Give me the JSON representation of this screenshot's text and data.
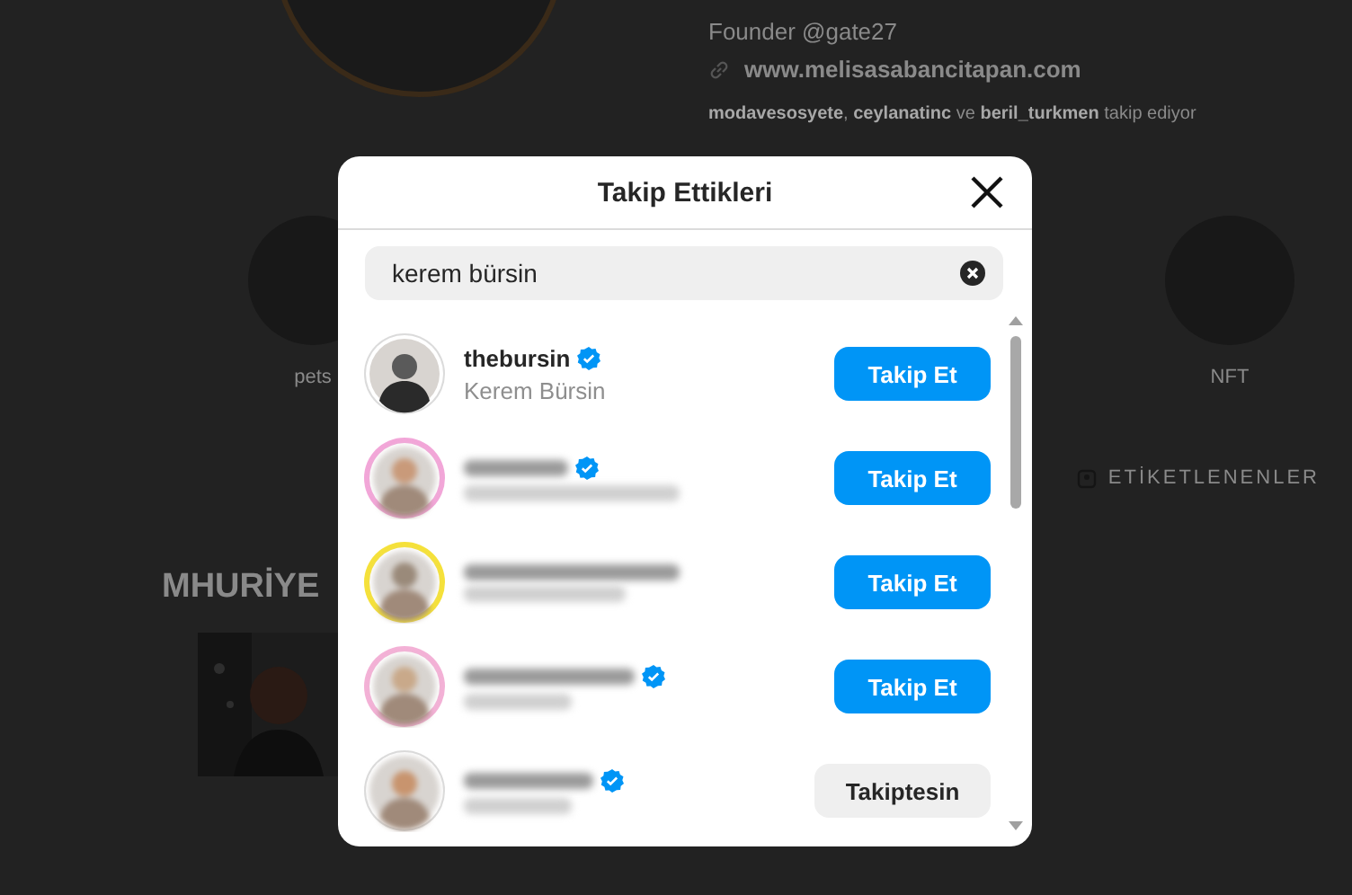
{
  "profile": {
    "bio": "Founder @gate27",
    "website": "www.melisasabancitapan.com",
    "followed_by": "**modavesosyete**, **ceylanatinc** ve **beril_turkmen** takip ediyor"
  },
  "highlights": [
    {
      "label": "pets"
    },
    {
      "label": "NFT"
    }
  ],
  "tabs": [
    {
      "label": "ETİKETLENENLER"
    }
  ],
  "section_title": "MHURİYE",
  "dialog": {
    "title": "Takip Ettikleri",
    "search": {
      "value": "kerem bürsin"
    },
    "users": [
      {
        "username": "thebursin",
        "full_name": "Kerem Bürsin",
        "verified": true,
        "blurred": false,
        "story_ring": false,
        "button": {
          "label": "Takip Et",
          "kind": "follow"
        }
      },
      {
        "verified": true,
        "blurred": true,
        "story_ring": true,
        "color": "#f2a6d8",
        "button": {
          "label": "Takip Et",
          "kind": "follow"
        }
      },
      {
        "verified": false,
        "blurred": true,
        "story_ring": true,
        "color": "#f5e13a",
        "button": {
          "label": "Takip Et",
          "kind": "follow"
        }
      },
      {
        "verified": true,
        "blurred": true,
        "story_ring": true,
        "color": "#f3b1d6",
        "button": {
          "label": "Takip Et",
          "kind": "follow"
        }
      },
      {
        "verified": true,
        "blurred": true,
        "story_ring": false,
        "button": {
          "label": "Takiptesin",
          "kind": "following"
        }
      }
    ]
  }
}
